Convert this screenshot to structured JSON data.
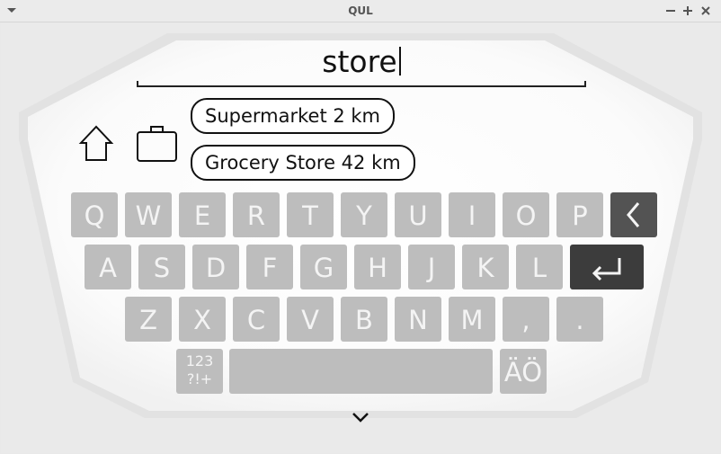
{
  "window": {
    "title": "QUL"
  },
  "input": {
    "text": "store"
  },
  "suggestions": [
    "Supermarket 2 km",
    "Grocery Store 42 km"
  ],
  "icons": {
    "home": "home-icon",
    "briefcase": "briefcase-icon",
    "backspace": "backspace-icon",
    "enter": "enter-icon",
    "hide": "chevron-down-icon"
  },
  "keyboard": {
    "row1": [
      "Q",
      "W",
      "E",
      "R",
      "T",
      "Y",
      "U",
      "I",
      "O",
      "P"
    ],
    "row2": [
      "A",
      "S",
      "D",
      "F",
      "G",
      "H",
      "J",
      "K",
      "L"
    ],
    "row3": [
      "Z",
      "X",
      "C",
      "V",
      "B",
      "N",
      "M",
      ",",
      "."
    ],
    "symbols_top": "123",
    "symbols_bottom": "?!+",
    "language_key": "ÄÖ"
  },
  "colors": {
    "key": "#bdbdbd",
    "key_text": "#f4f4f4",
    "backspace": "#535353",
    "enter": "#3c3c3c"
  }
}
